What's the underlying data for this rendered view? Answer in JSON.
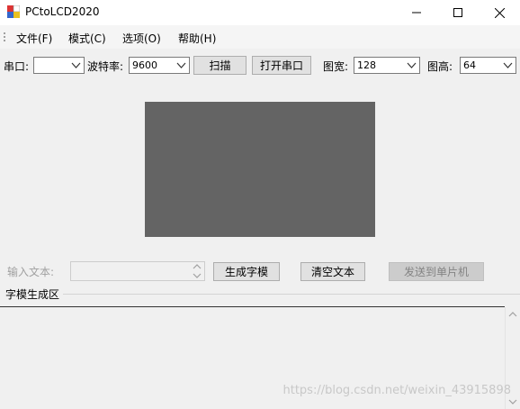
{
  "window": {
    "title": "PCtoLCD2020"
  },
  "menu": [
    "文件(F)",
    "模式(C)",
    "选项(O)",
    "帮助(H)"
  ],
  "toolbar": {
    "port_label": "串口:",
    "port_value": "",
    "baud_label": "波特率:",
    "baud_value": "9600",
    "scan_label": "扫描",
    "open_port_label": "打开串口",
    "width_label": "图宽:",
    "width_value": "128",
    "height_label": "图高:",
    "height_value": "64"
  },
  "input_row": {
    "input_label": "输入文本:",
    "input_value": "",
    "generate_label": "生成字模",
    "clear_label": "清空文本",
    "send_label": "发送到单片机"
  },
  "output": {
    "section_label": "字模生成区",
    "text": ""
  },
  "watermark": "https://blog.csdn.net/weixin_43915898",
  "colors": {
    "preview": "#646464",
    "window_bg": "#f0f0f0"
  }
}
